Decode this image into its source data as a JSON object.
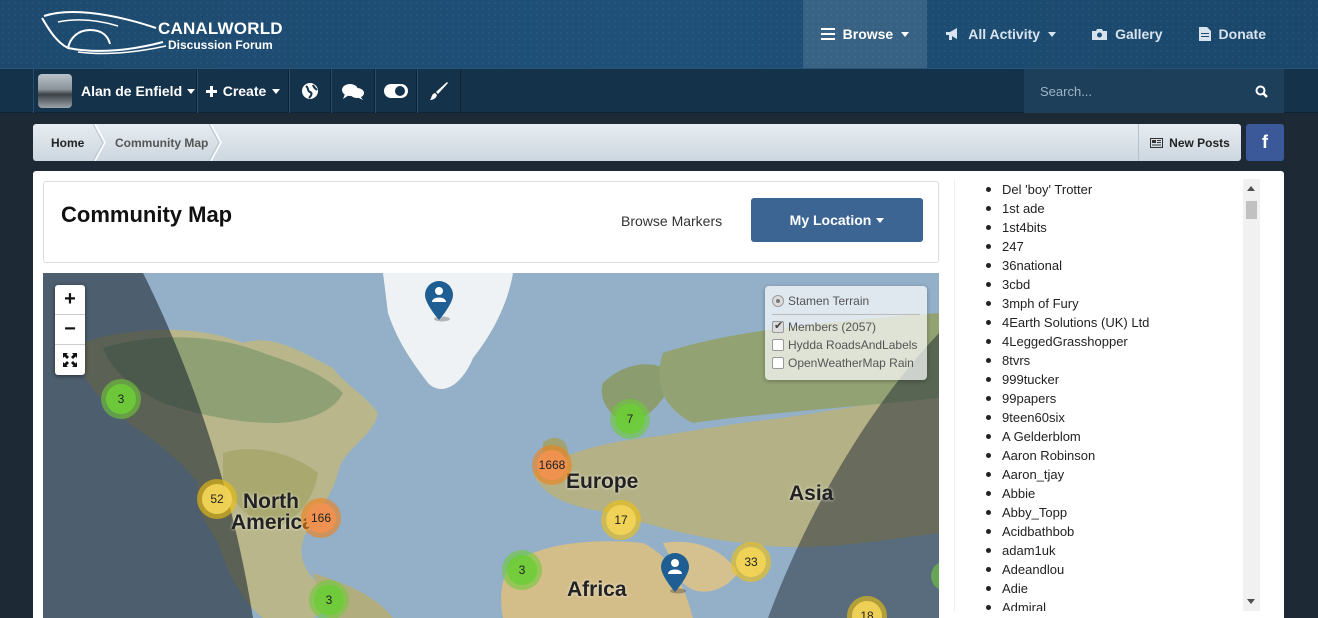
{
  "brand": {
    "title": "CANALWORLD",
    "subtitle": "Discussion Forum"
  },
  "topnav": [
    {
      "label": "Browse",
      "icon": "list-icon",
      "active": true,
      "dropdown": true
    },
    {
      "label": "All Activity",
      "icon": "megaphone-icon",
      "active": false,
      "dropdown": true
    },
    {
      "label": "Gallery",
      "icon": "camera-icon",
      "active": false,
      "dropdown": false
    },
    {
      "label": "Donate",
      "icon": "document-icon",
      "active": false,
      "dropdown": false
    }
  ],
  "userbar": {
    "username": "Alan de Enfield",
    "create_label": "Create",
    "search_placeholder": "Search..."
  },
  "breadcrumb": {
    "home": "Home",
    "current": "Community Map"
  },
  "new_posts": "New Posts",
  "facebook_glyph": "f",
  "page": {
    "title": "Community Map",
    "browse_markers": "Browse Markers",
    "my_location": "My Location"
  },
  "map": {
    "layers": {
      "base": "Stamen Terrain",
      "overlays": [
        {
          "label": "Members (2057)",
          "checked": true
        },
        {
          "label": "Hydda RoadsAndLabels",
          "checked": false
        },
        {
          "label": "OpenWeatherMap Rain",
          "checked": false
        }
      ]
    },
    "labels": {
      "north_america_1": "North",
      "north_america_2": "America",
      "europe": "Europe",
      "asia": "Asia",
      "africa": "Africa"
    },
    "clusters": {
      "alaska": "3",
      "scandinavia": "7",
      "uk": "1668",
      "west_us": "52",
      "east_us": "166",
      "med": "17",
      "west_africa": "3",
      "middle_east": "33",
      "caribbean": "3",
      "india": "18"
    }
  },
  "members": [
    "Del 'boy' Trotter",
    "1st ade",
    "1st4bits",
    "247",
    "36national",
    "3cbd",
    "3mph of Fury",
    "4Earth Solutions (UK) Ltd",
    "4LeggedGrasshopper",
    "8tvrs",
    "999tucker",
    "99papers",
    "9teen60six",
    "A Gelderblom",
    "Aaron Robinson",
    "Aaron_tjay",
    "Abbie",
    "Abby_Topp",
    "Acidbathbob",
    "adam1uk",
    "Adeandlou",
    "Adie",
    "Admiral"
  ]
}
